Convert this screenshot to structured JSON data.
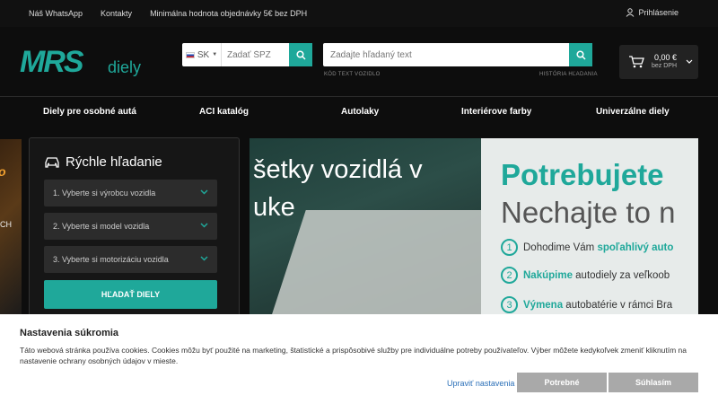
{
  "topbar": {
    "links": [
      "Náš WhatsApp",
      "Kontakty",
      "Minimálna hodnota objednávky 5€ bez DPH"
    ],
    "login": "Prihlásenie"
  },
  "logo": {
    "main": "MRS",
    "sub": "diely"
  },
  "spz": {
    "country": "SK",
    "placeholder": "Zadať ŠPZ"
  },
  "search": {
    "placeholder": "Zadajte hľadaný text",
    "sub_left": "KÓD TEXT VOZIDLO",
    "sub_right": "HISTÓRIA HĽADANIA"
  },
  "cart": {
    "price": "0,00 €",
    "note": "bez DPH"
  },
  "nav": [
    "Diely pre osobné autá",
    "ACI katalóg",
    "Autolaky",
    "Interiérove farby",
    "Univerzálne diely"
  ],
  "left_banner": {
    "t1": "o",
    "t2": "CH"
  },
  "quick": {
    "title": "Rýchle hľadanie",
    "selects": [
      "1. Vyberte si výrobcu vozidla",
      "2. Vyberte si model vozidla",
      "3. Vyberte si motorizáciu vozidla"
    ],
    "button": "HĽADAŤ DIELY"
  },
  "hero": {
    "line1": "šetky vozidlá v",
    "line2": "uke",
    "big1": "Potrebujete",
    "big2": "Nechajte to n",
    "bullets": [
      {
        "n": "1",
        "pre": "Dohodime Vám ",
        "b": "spoľahlivý auto",
        "post": ""
      },
      {
        "n": "2",
        "pre": "",
        "b": "Nakúpime",
        "post": " autodiely za veľkoob"
      },
      {
        "n": "3",
        "pre": "",
        "b": "Výmena",
        "post": " autobatérie v rámci Bra"
      }
    ]
  },
  "cookie": {
    "title": "Nastavenia súkromia",
    "text": "Táto webová stránka používa cookies. Cookies môžu byť použité na marketing, štatistické a prispôsobivé služby pre individuálne potreby používateľov. Výber môžete kedykoľvek zmeniť kliknutím na nastavenie ochrany osobných údajov v mieste.",
    "edit": "Upraviť nastavenia",
    "necessary": "Potrebné",
    "agree": "Súhlasím"
  },
  "colors": {
    "accent": "#1fa89a",
    "background": "#0d0d0d",
    "cookie_btn": "#a9a9a9"
  }
}
